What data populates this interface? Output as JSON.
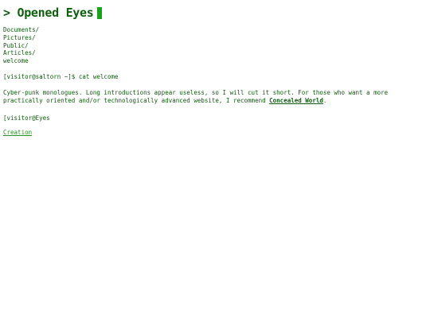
{
  "header": {
    "title": "> Opened Eyes",
    "cursor_color": "#18a418"
  },
  "directory": {
    "entries": [
      "Documents/",
      "Pictures/",
      "Public/",
      "Articles/",
      "welcome"
    ]
  },
  "terminal": {
    "command_line": "[visitor@saltorn ~]$ cat welcome",
    "intro_text": "Cyber-punk monologues. Long introductions appear useless, so I will cut it short. For those who want a more practically oriented and/or technologically advanced website, I recommend ",
    "intro_link": "Concealed World",
    "intro_end": ".",
    "end_prompt": "[visitor@Eyes"
  },
  "footer": {
    "creation_link": "Creation"
  },
  "colors": {
    "text": "#0d5a0d",
    "link": "#2b8f2b",
    "background": "#ffffff"
  }
}
